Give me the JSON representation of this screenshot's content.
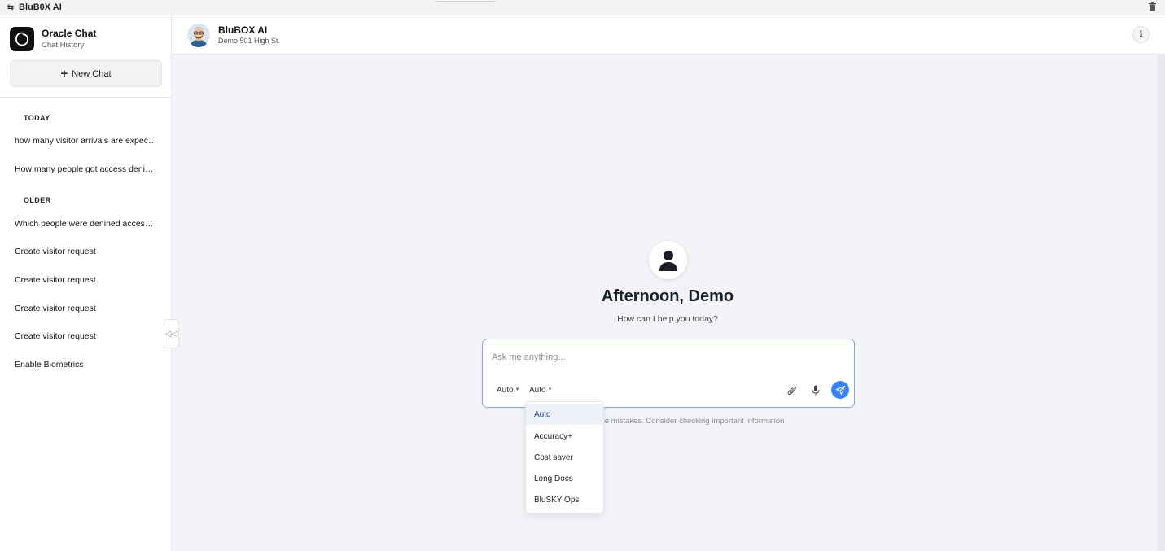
{
  "window": {
    "title": "BluB0X AI"
  },
  "sidebar": {
    "brand_title": "Oracle Chat",
    "brand_subtitle": "Chat History",
    "new_chat_label": "New Chat",
    "sections": [
      {
        "heading": "TODAY",
        "items": [
          "how many visitor arrivals are expected today",
          "How many people got access denied today"
        ]
      },
      {
        "heading": "OLDER",
        "items": [
          "Which people were denined access today",
          "Create visitor request",
          "Create visitor request",
          "Create visitor request",
          "Create visitor request",
          "Enable Biometrics"
        ]
      }
    ]
  },
  "header": {
    "title": "BluBOX AI",
    "subtitle": "Demo 501 High St.",
    "info_label": "i"
  },
  "main": {
    "greeting": "Afternoon, Demo",
    "subgreeting": "How can I help you today?",
    "input_placeholder": "Ask me anything...",
    "selectors": [
      "Auto",
      "Auto"
    ],
    "disclaimer": "ke mistakes. Consider checking important information"
  },
  "dropdown": {
    "selected": "Auto",
    "options": [
      "Auto",
      "Accuracy+",
      "Cost saver",
      "Long Docs",
      "BluSKY Ops"
    ]
  },
  "colors": {
    "accent": "#3b82f6",
    "selected_text": "#1e3a8a",
    "background": "#f3f4f8"
  }
}
